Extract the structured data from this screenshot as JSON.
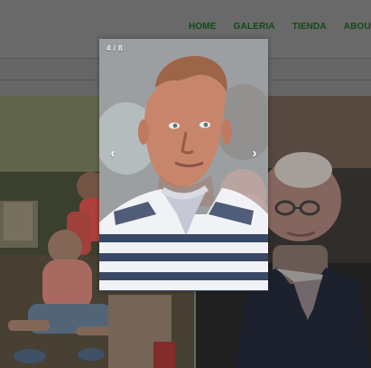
{
  "nav": {
    "items": [
      {
        "label": "HOME"
      },
      {
        "label": "GALERIA"
      },
      {
        "label": "TIENDA"
      },
      {
        "label": "ABOUT ME"
      }
    ]
  },
  "lightbox": {
    "counter": "4 / 8",
    "prev_icon": "‹",
    "next_icon": "›"
  },
  "icons": {
    "previous": "chevron-left-icon",
    "next": "chevron-right-icon"
  },
  "colors": {
    "nav_text": "#164c1c",
    "overlay": "#6f6f6f",
    "lightbox_text": "#ffffff"
  }
}
